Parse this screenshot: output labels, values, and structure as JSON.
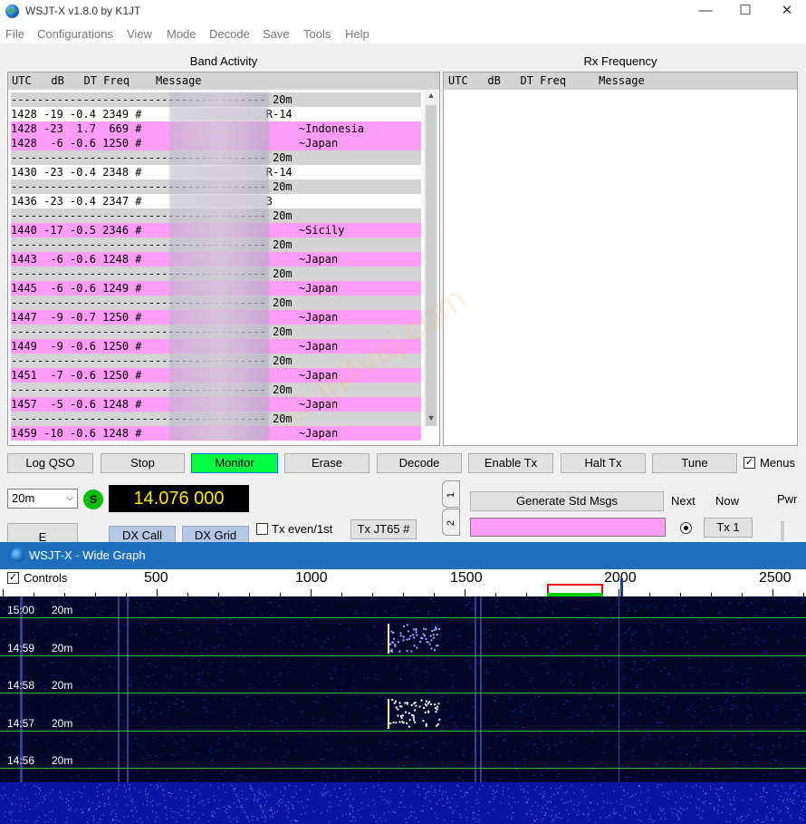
{
  "window": {
    "title": "WSJT-X   v1.8.0   by K1JT",
    "minimize": "—",
    "maximize": "☐",
    "close": "✕"
  },
  "menu": [
    "File",
    "Configurations",
    "View",
    "Mode",
    "Decode",
    "Save",
    "Tools",
    "Help"
  ],
  "band_activity": {
    "label": "Band Activity",
    "header": "UTC   dB   DT Freq    Message",
    "rows": [
      {
        "type": "sep",
        "text": "--------------------------------------- 20m"
      },
      {
        "type": "plain",
        "text": "1428 -19 -0.4 2349 #                   R-14"
      },
      {
        "type": "cq",
        "text": "1428 -23  1.7  669 #                        ~Indonesia"
      },
      {
        "type": "cq",
        "text": "1428  -6 -0.6 1250 #                        ~Japan"
      },
      {
        "type": "sep",
        "text": "--------------------------------------- 20m"
      },
      {
        "type": "plain",
        "text": "1430 -23 -0.4 2348 #                   R-14"
      },
      {
        "type": "sep",
        "text": "--------------------------------------- 20m"
      },
      {
        "type": "plain",
        "text": "1436 -23 -0.4 2347 #                   3"
      },
      {
        "type": "sep",
        "text": "--------------------------------------- 20m"
      },
      {
        "type": "cq",
        "text": "1440 -17 -0.5 2346 #                        ~Sicily"
      },
      {
        "type": "sep",
        "text": "--------------------------------------- 20m"
      },
      {
        "type": "cq",
        "text": "1443  -6 -0.6 1248 #                        ~Japan"
      },
      {
        "type": "sep",
        "text": "--------------------------------------- 20m"
      },
      {
        "type": "cq",
        "text": "1445  -6 -0.6 1249 #                        ~Japan"
      },
      {
        "type": "sep",
        "text": "--------------------------------------- 20m"
      },
      {
        "type": "cq",
        "text": "1447  -9 -0.7 1250 #                        ~Japan"
      },
      {
        "type": "sep",
        "text": "--------------------------------------- 20m"
      },
      {
        "type": "cq",
        "text": "1449  -9 -0.6 1250 #                        ~Japan"
      },
      {
        "type": "sep",
        "text": "--------------------------------------- 20m"
      },
      {
        "type": "cq",
        "text": "1451  -7 -0.6 1250 #                        ~Japan"
      },
      {
        "type": "sep",
        "text": "--------------------------------------- 20m"
      },
      {
        "type": "cq",
        "text": "1457  -5 -0.6 1248 #                        ~Japan"
      },
      {
        "type": "sep",
        "text": "--------------------------------------- 20m"
      },
      {
        "type": "cq",
        "text": "1459 -10 -0.6 1248 #                        ~Japan"
      }
    ]
  },
  "rx_frequency": {
    "label": "Rx Frequency",
    "header": "UTC   dB   DT Freq     Message"
  },
  "buttons": {
    "log_qso": "Log QSO",
    "stop": "Stop",
    "monitor": "Monitor",
    "erase": "Erase",
    "decode": "Decode",
    "enable_tx": "Enable Tx",
    "halt_tx": "Halt Tx",
    "tune": "Tune",
    "menus": "Menus",
    "generate_std_msgs": "Generate Std Msgs",
    "next": "Next",
    "now": "Now",
    "tx1": "Tx 1",
    "dx_call": "DX Call",
    "dx_grid": "DX Grid",
    "tx_even": "Tx even/1st",
    "tx_mode": "Tx JT65  #",
    "pwr": "Pwr",
    "e_btn": "E"
  },
  "band": "20m",
  "s_indicator": "S",
  "dial_frequency": "14.076 000",
  "tabs": [
    "1",
    "2"
  ],
  "wide_graph": {
    "title": "WSJT-X - Wide Graph",
    "controls_label": "Controls",
    "scale_labels": [
      "500",
      "1000",
      "1500",
      "2000",
      "2500"
    ],
    "time_rows": [
      {
        "time": "15:00",
        "band": "20m"
      },
      {
        "time": "14:59",
        "band": "20m"
      },
      {
        "time": "14:58",
        "band": "20m"
      },
      {
        "time": "14:57",
        "band": "20m"
      },
      {
        "time": "14:56",
        "band": "20m"
      }
    ]
  },
  "colors": {
    "cq_highlight": "#ff9cf7",
    "separator": "#d4d4d4",
    "monitor_on": "#00ff40",
    "freq_text": "#ffe600",
    "waterfall_bg": "#06062a",
    "wide_graph_title": "#1f6fbf"
  }
}
